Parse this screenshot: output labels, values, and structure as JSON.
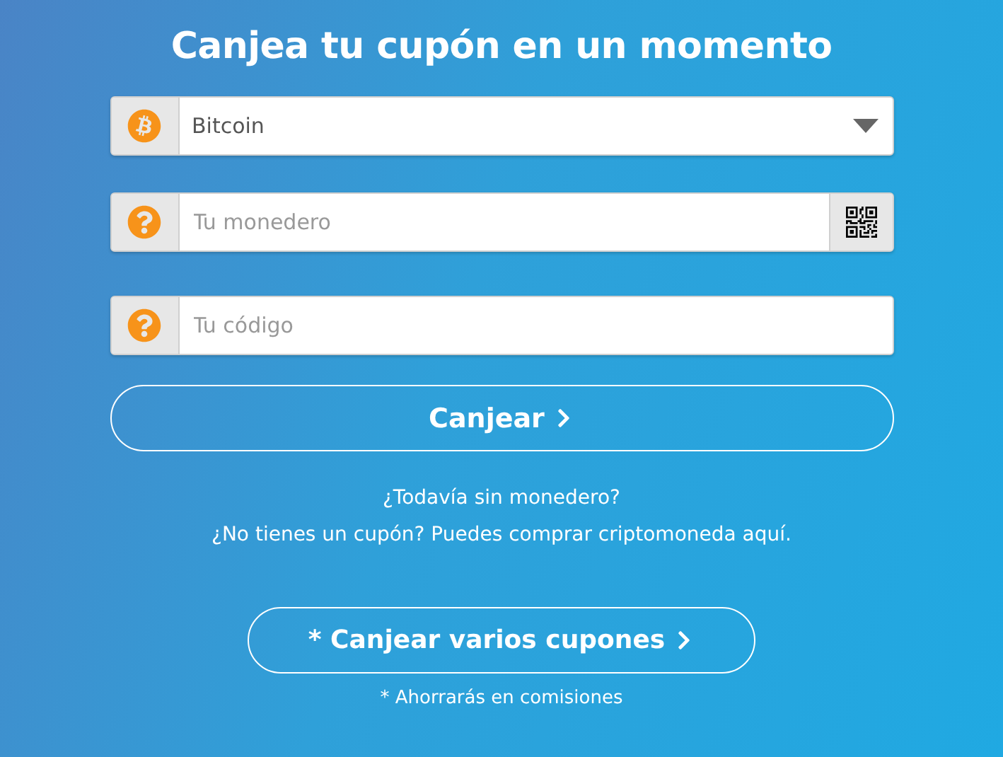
{
  "title": "Canjea tu cupón en un momento",
  "fields": [
    {
      "kind": "select",
      "value": "Bitcoin"
    },
    {
      "kind": "input-qr",
      "placeholder": "Tu monedero"
    },
    {
      "kind": "input",
      "placeholder": "Tu código"
    }
  ],
  "redeem_button": "Canjear",
  "links": [
    "¿Todavía sin monedero?",
    "¿No tienes un cupón? Puedes comprar criptomoneda aquí."
  ],
  "bulk_button": "* Canjear varios cupones",
  "note": "* Ahorrarás en comisiones"
}
